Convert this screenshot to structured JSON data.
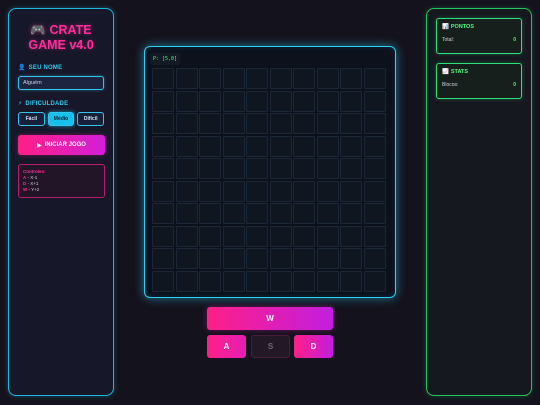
{
  "title": {
    "emoji": "🎮",
    "line1": "CRATE",
    "line2": "GAME v4.0"
  },
  "player": {
    "label": "SEU NOME",
    "label_icon": "👤",
    "name_value": "Alguém"
  },
  "difficulty": {
    "label": "DIFICULDADE",
    "label_icon": "⚡",
    "options": [
      "Fácil",
      "Médio",
      "Difícil"
    ],
    "selected": "Médio"
  },
  "start_button": {
    "icon": "▶",
    "label": "INICIAR JOGO"
  },
  "controls": {
    "title": "Controles:",
    "items": [
      {
        "key": "A",
        "desc": " - X-1"
      },
      {
        "key": "D",
        "desc": " - X+1"
      },
      {
        "key": "W",
        "desc": " - Y+2"
      }
    ]
  },
  "board": {
    "position_label": "P: [5,0]",
    "rows": 10,
    "cols": 10
  },
  "move_buttons": {
    "up": "W",
    "left": "A",
    "down": "S",
    "right": "D"
  },
  "stats": {
    "points_card": {
      "icon": "📊",
      "title": "PONTOS",
      "label": "Total:",
      "value": "0"
    },
    "stats_card": {
      "icon": "📈",
      "title": "STATS",
      "label": "Blocos:",
      "value": "0"
    }
  },
  "colors": {
    "accent_cyan": "#2ad0f5",
    "accent_pink": "#ff2e9a",
    "accent_green": "#4aff7a"
  }
}
